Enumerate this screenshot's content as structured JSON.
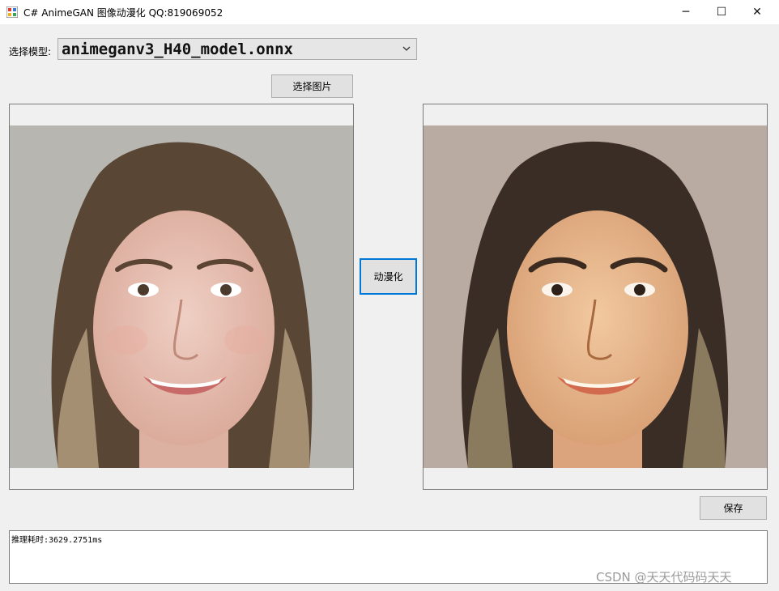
{
  "window": {
    "title": "C# AnimeGAN 图像动漫化 QQ:819069052",
    "minimize_glyph": "─",
    "maximize_glyph": "☐",
    "close_glyph": "✕"
  },
  "model": {
    "label": "选择模型:",
    "selected": "animeganv3_H40_model.onnx"
  },
  "buttons": {
    "select_image": "选择图片",
    "animate": "动漫化",
    "save": "保存"
  },
  "log": {
    "text": "推理耗时:3629.2751ms"
  },
  "watermark": "CSDN @天天代码码天天",
  "colors": {
    "focus": "#0078d7",
    "window_bg": "#f0f0f0"
  }
}
